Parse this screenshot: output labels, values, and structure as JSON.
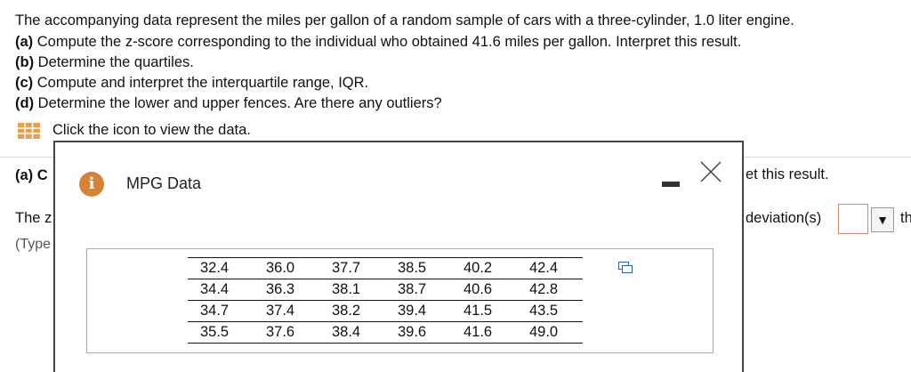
{
  "question": {
    "intro": "The accompanying data represent the miles per gallon of a random sample of cars with a three-cylinder, 1.0 liter engine.",
    "parts": [
      {
        "label": "(a)",
        "text": "Compute the z-score corresponding to the individual who obtained 41.6 miles per gallon. Interpret this result."
      },
      {
        "label": "(b)",
        "text": "Determine the quartiles."
      },
      {
        "label": "(c)",
        "text": "Compute and interpret the interquartile range, IQR."
      },
      {
        "label": "(d)",
        "text": "Determine the lower and upper fences. Are there any outliers?"
      }
    ],
    "data_link": "Click the icon to view the data."
  },
  "background": {
    "a_label": "(a) C",
    "the_fragment": "The z",
    "type_fragment": "(Type",
    "interp_fragment": "et this result.",
    "deviation_fragment": "deviation(s)",
    "dropdown_arrow": "▼",
    "th_fragment": "th"
  },
  "dialog": {
    "title": "MPG Data",
    "info_icon_glyph": "i",
    "table": [
      [
        "32.4",
        "36.0",
        "37.7",
        "38.5",
        "40.2",
        "42.4"
      ],
      [
        "34.4",
        "36.3",
        "38.1",
        "38.7",
        "40.6",
        "42.8"
      ],
      [
        "34.7",
        "37.4",
        "38.2",
        "39.4",
        "41.5",
        "43.5"
      ],
      [
        "35.5",
        "37.6",
        "38.4",
        "39.6",
        "41.6",
        "49.0"
      ]
    ]
  },
  "colors": {
    "info_icon": "#d4843a",
    "grid_icon": "#e8a04a",
    "input_border": "#d28b6b"
  }
}
